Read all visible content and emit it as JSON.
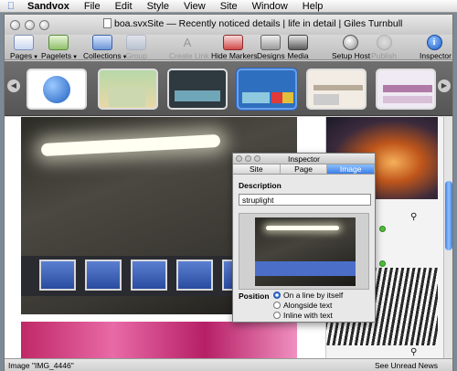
{
  "menubar": {
    "app_name": "Sandvox",
    "items": [
      "File",
      "Edit",
      "Style",
      "View",
      "Site",
      "Window",
      "Help"
    ]
  },
  "window": {
    "title": "boa.svxSite — Recently noticed details | life in detail | Giles Turnbull"
  },
  "toolbar": {
    "pages": "Pages",
    "pagelets": "Pagelets",
    "collections": "Collections",
    "group": "Group",
    "create_link": "Create Link",
    "hide_markers": "Hide Markers",
    "designs": "Designs",
    "media": "Media",
    "setup_host": "Setup Host",
    "publish": "Publish",
    "inspector": "Inspector"
  },
  "statusbar": {
    "left": "Image  \"IMG_4446\"",
    "right": "See Unread News"
  },
  "inspector": {
    "title": "Inspector",
    "tabs": [
      "Site",
      "Page",
      "Image"
    ],
    "active_tab": "Image",
    "description_label": "Description",
    "description_value": "struplight",
    "position_label": "Position",
    "options": [
      "On a line by itself",
      "Alongside text",
      "Inline with text"
    ],
    "selected_option": "On a line by itself"
  },
  "icons": {
    "apple": "apple-menu-icon",
    "magnifier": "magnifier-icon",
    "left_arrow": "arrow-left-icon",
    "right_arrow": "arrow-right-icon"
  }
}
